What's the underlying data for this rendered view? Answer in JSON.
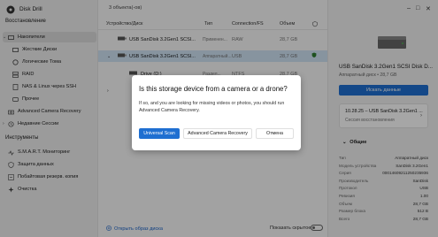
{
  "app": {
    "title": "Disk Drill"
  },
  "sidebar": {
    "restore_header": "Восстановление",
    "tools_header": "Инструменты",
    "items": [
      {
        "label": "Накопители",
        "icon": "drives-icon"
      },
      {
        "label": "Жесткие Диски",
        "icon": "hard-drive-icon"
      },
      {
        "label": "Логические Тома",
        "icon": "volume-icon"
      },
      {
        "label": "RAID",
        "icon": "raid-icon"
      },
      {
        "label": "NAS & Linux через SSH",
        "icon": "nas-icon"
      },
      {
        "label": "Прочее",
        "icon": "other-icon"
      },
      {
        "label": "Advanced Camera Recovery",
        "icon": "camera-icon"
      },
      {
        "label": "Недавние Сессии",
        "icon": "sessions-icon"
      }
    ],
    "tools": [
      {
        "label": "S.M.A.R.T. Мониторинг",
        "icon": "smart-icon"
      },
      {
        "label": "Защита данных",
        "icon": "shield-icon"
      },
      {
        "label": "Побайтовая резерв. копия",
        "icon": "backup-icon"
      },
      {
        "label": "Очистка",
        "icon": "cleanup-icon"
      }
    ]
  },
  "main": {
    "object_count": "3 объекта(-ов)",
    "columns": {
      "device": "Устройство/Диск",
      "type": "Тип",
      "connection": "Connection/FS",
      "size": "Объем"
    },
    "rows": [
      {
        "name": "USB  SanDisk 3.2Gen1 SCSI...",
        "type": "Применен...",
        "conn": "RAW",
        "size": "28,7 GB"
      },
      {
        "name": "USB  SanDisk 3.2Gen1 SCSI...",
        "type": "Аппаратный...",
        "conn": "USB",
        "size": "28,7 GB"
      },
      {
        "name": "Drive (D:)",
        "type": "Раздел...",
        "conn": "NTFS",
        "size": "28,7 GB"
      }
    ],
    "open_image": "Открыть образ диска",
    "show_hidden": "Показать скрытое"
  },
  "panel": {
    "disk_name": "USB  SanDisk 3.2Gen1 SCSI Disk D...",
    "disk_sub": "Аппаратный диск  •  28,7 GB",
    "find_button": "Искать данные",
    "session_title": "10.28.25 – USB  SanDisk 3.2Gen1 ...",
    "session_sub": "Сессия восстановления",
    "general_header": "Общие",
    "props": [
      {
        "k": "Тип",
        "v": "Аппаратный диск"
      },
      {
        "k": "Модель устройства",
        "v": "SanDisk 3.2Gen1"
      },
      {
        "k": "Серия",
        "v": "00014609211250235936"
      },
      {
        "k": "Производитель",
        "v": "SanDisk"
      },
      {
        "k": "Протокол",
        "v": "USB"
      },
      {
        "k": "Ревизия",
        "v": "1.00"
      },
      {
        "k": "Объем",
        "v": "28,7 GB"
      },
      {
        "k": "Размер блока",
        "v": "512 B"
      },
      {
        "k": "Всего",
        "v": "28,7 GB"
      }
    ]
  },
  "modal": {
    "title": "Is this storage device from a camera or a drone?",
    "text": "If so, and you are looking for missing videos or photos, you should run Advanced Camera Recovery.",
    "universal": "Universal Scan",
    "advanced": "Advanced Camera Recovery",
    "cancel": "Отмена"
  },
  "colors": {
    "accent": "#1f6fd1",
    "selection": "#cfe3f5"
  }
}
